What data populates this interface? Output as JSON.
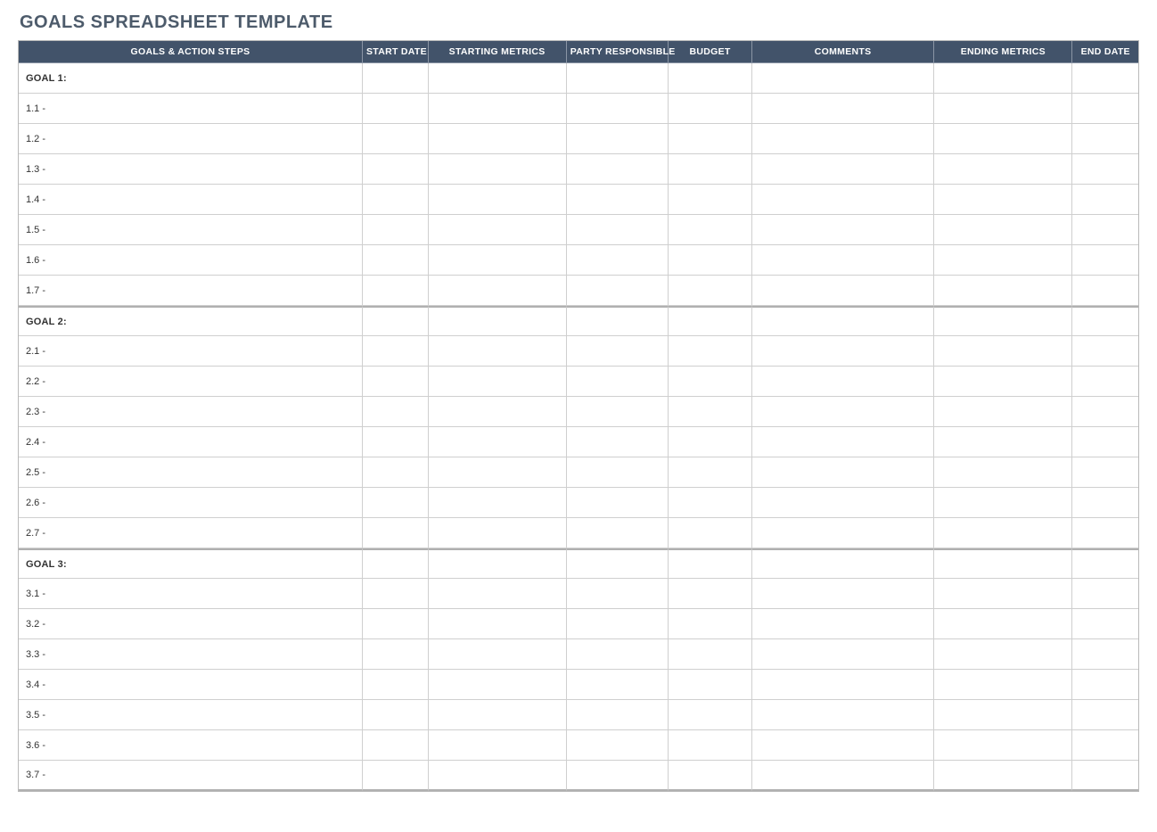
{
  "title": "GOALS SPREADSHEET TEMPLATE",
  "columns": {
    "goal": "GOALS & ACTION STEPS",
    "start_date": "START DATE",
    "start_metric": "STARTING METRICS",
    "party": "PARTY RESPONSIBLE",
    "budget": "BUDGET",
    "comments": "COMMENTS",
    "end_metric": "ENDING METRICS",
    "end_date": "END DATE"
  },
  "groups": [
    {
      "label": "GOAL 1:",
      "steps": [
        {
          "label": "1.1 -",
          "start_date": "",
          "start_metric": "",
          "party": "",
          "budget": "",
          "comments": "",
          "end_metric": "",
          "end_date": ""
        },
        {
          "label": "1.2 -",
          "start_date": "",
          "start_metric": "",
          "party": "",
          "budget": "",
          "comments": "",
          "end_metric": "",
          "end_date": ""
        },
        {
          "label": "1.3 -",
          "start_date": "",
          "start_metric": "",
          "party": "",
          "budget": "",
          "comments": "",
          "end_metric": "",
          "end_date": ""
        },
        {
          "label": "1.4 -",
          "start_date": "",
          "start_metric": "",
          "party": "",
          "budget": "",
          "comments": "",
          "end_metric": "",
          "end_date": ""
        },
        {
          "label": "1.5 -",
          "start_date": "",
          "start_metric": "",
          "party": "",
          "budget": "",
          "comments": "",
          "end_metric": "",
          "end_date": ""
        },
        {
          "label": "1.6 -",
          "start_date": "",
          "start_metric": "",
          "party": "",
          "budget": "",
          "comments": "",
          "end_metric": "",
          "end_date": ""
        },
        {
          "label": "1.7 -",
          "start_date": "",
          "start_metric": "",
          "party": "",
          "budget": "",
          "comments": "",
          "end_metric": "",
          "end_date": ""
        }
      ],
      "start_date": "",
      "start_metric": "",
      "party": "",
      "budget": "",
      "comments": "",
      "end_metric": "",
      "end_date": ""
    },
    {
      "label": "GOAL 2:",
      "steps": [
        {
          "label": "2.1 -",
          "start_date": "",
          "start_metric": "",
          "party": "",
          "budget": "",
          "comments": "",
          "end_metric": "",
          "end_date": ""
        },
        {
          "label": "2.2 -",
          "start_date": "",
          "start_metric": "",
          "party": "",
          "budget": "",
          "comments": "",
          "end_metric": "",
          "end_date": ""
        },
        {
          "label": "2.3 -",
          "start_date": "",
          "start_metric": "",
          "party": "",
          "budget": "",
          "comments": "",
          "end_metric": "",
          "end_date": ""
        },
        {
          "label": "2.4 -",
          "start_date": "",
          "start_metric": "",
          "party": "",
          "budget": "",
          "comments": "",
          "end_metric": "",
          "end_date": ""
        },
        {
          "label": "2.5 -",
          "start_date": "",
          "start_metric": "",
          "party": "",
          "budget": "",
          "comments": "",
          "end_metric": "",
          "end_date": ""
        },
        {
          "label": "2.6 -",
          "start_date": "",
          "start_metric": "",
          "party": "",
          "budget": "",
          "comments": "",
          "end_metric": "",
          "end_date": ""
        },
        {
          "label": "2.7 -",
          "start_date": "",
          "start_metric": "",
          "party": "",
          "budget": "",
          "comments": "",
          "end_metric": "",
          "end_date": ""
        }
      ],
      "start_date": "",
      "start_metric": "",
      "party": "",
      "budget": "",
      "comments": "",
      "end_metric": "",
      "end_date": ""
    },
    {
      "label": "GOAL 3:",
      "steps": [
        {
          "label": "3.1 -",
          "start_date": "",
          "start_metric": "",
          "party": "",
          "budget": "",
          "comments": "",
          "end_metric": "",
          "end_date": ""
        },
        {
          "label": "3.2 -",
          "start_date": "",
          "start_metric": "",
          "party": "",
          "budget": "",
          "comments": "",
          "end_metric": "",
          "end_date": ""
        },
        {
          "label": "3.3 -",
          "start_date": "",
          "start_metric": "",
          "party": "",
          "budget": "",
          "comments": "",
          "end_metric": "",
          "end_date": ""
        },
        {
          "label": "3.4 -",
          "start_date": "",
          "start_metric": "",
          "party": "",
          "budget": "",
          "comments": "",
          "end_metric": "",
          "end_date": ""
        },
        {
          "label": "3.5 -",
          "start_date": "",
          "start_metric": "",
          "party": "",
          "budget": "",
          "comments": "",
          "end_metric": "",
          "end_date": ""
        },
        {
          "label": "3.6 -",
          "start_date": "",
          "start_metric": "",
          "party": "",
          "budget": "",
          "comments": "",
          "end_metric": "",
          "end_date": ""
        },
        {
          "label": "3.7 -",
          "start_date": "",
          "start_metric": "",
          "party": "",
          "budget": "",
          "comments": "",
          "end_metric": "",
          "end_date": ""
        }
      ],
      "start_date": "",
      "start_metric": "",
      "party": "",
      "budget": "",
      "comments": "",
      "end_metric": "",
      "end_date": ""
    }
  ]
}
